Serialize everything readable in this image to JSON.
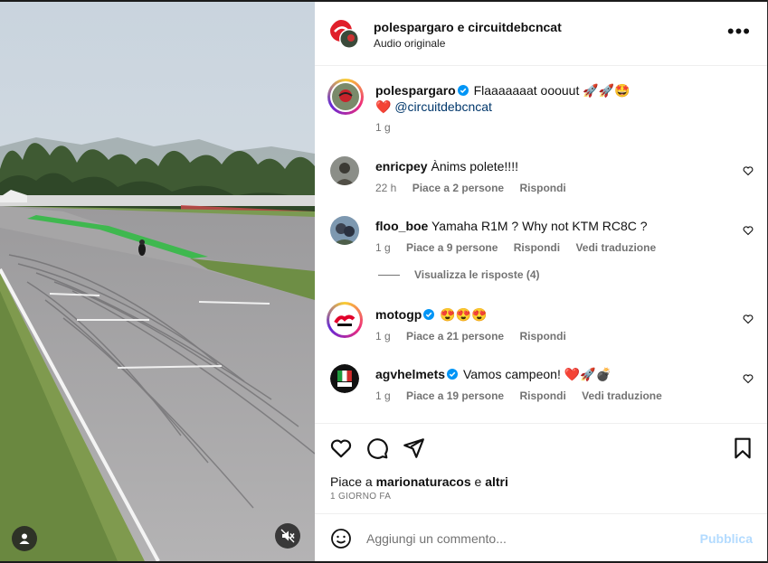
{
  "header": {
    "title": "polespargaro e circuitdebcncat",
    "subtitle": "Audio originale",
    "more_icon": "more-horizontal-icon"
  },
  "caption": {
    "user": "polespargaro",
    "text": "Flaaaaaaat ooouut 🚀🚀🤩",
    "line2_emoji": "❤️",
    "mention": "@circuitdebcncat",
    "time": "1 g"
  },
  "comments": [
    {
      "user": "enricpey",
      "text": "Ànims polete!!!!",
      "time": "22 h",
      "likes": "Piace a 2 persone",
      "reply": "Rispondi",
      "translate": ""
    },
    {
      "user": "floo_boe",
      "text": "Yamaha R1M ? Why not KTM RC8C ?",
      "time": "1 g",
      "likes": "Piace a 9 persone",
      "reply": "Rispondi",
      "translate": "Vedi traduzione"
    },
    {
      "user": "motogp",
      "text": "😍😍😍",
      "time": "1 g",
      "likes": "Piace a 21 persone",
      "reply": "Rispondi",
      "translate": ""
    },
    {
      "user": "agvhelmets",
      "text": "Vamos campeon! ❤️🚀💣",
      "time": "1 g",
      "likes": "Piace a 19 persone",
      "reply": "Rispondi",
      "translate": "Vedi traduzione"
    }
  ],
  "view_replies": "Visualizza le risposte (4)",
  "likes_line": {
    "prefix": "Piace a ",
    "user": "marionaturacos",
    "middle": " e ",
    "others": "altri"
  },
  "date": "1 GIORNO FA",
  "add_comment": {
    "placeholder": "Aggiungi un commento...",
    "post": "Pubblica"
  },
  "colors": {
    "verified": "#0095f6",
    "muted_text": "#737373",
    "post_disabled": "#b3dbff",
    "mention": "#00376b"
  }
}
